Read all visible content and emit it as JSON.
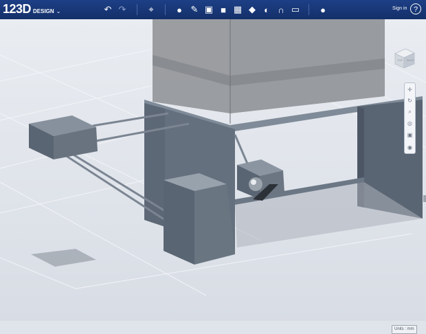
{
  "app": {
    "logo": "123D",
    "logo_sub": "DESIGN",
    "menu_caret": "⌄"
  },
  "toolbar": {
    "undo": "↶",
    "redo": "↷",
    "transform": "⌖",
    "primitives": "●",
    "sketch": "✎",
    "construct": "▣",
    "modify": "■",
    "pattern": "▦",
    "grouping": "◆",
    "combine": "◐",
    "snap": "∩",
    "measure": "▭",
    "material": "●"
  },
  "header": {
    "sign_in": "Sign in",
    "help": "?"
  },
  "viewcube": {
    "top_face": "TOP",
    "front_face": "BACK"
  },
  "navbar": {
    "pan": "✛",
    "orbit": "↻",
    "zoom": "⌕",
    "fit": "◎",
    "views": "▣",
    "visibility": "◉"
  },
  "status": {
    "units": "Units : mm"
  },
  "colors": {
    "toolbar": "#1d3f86",
    "background": "#dfe3ea",
    "model_body": "#5d6876",
    "model_top": "#7f8b98"
  }
}
